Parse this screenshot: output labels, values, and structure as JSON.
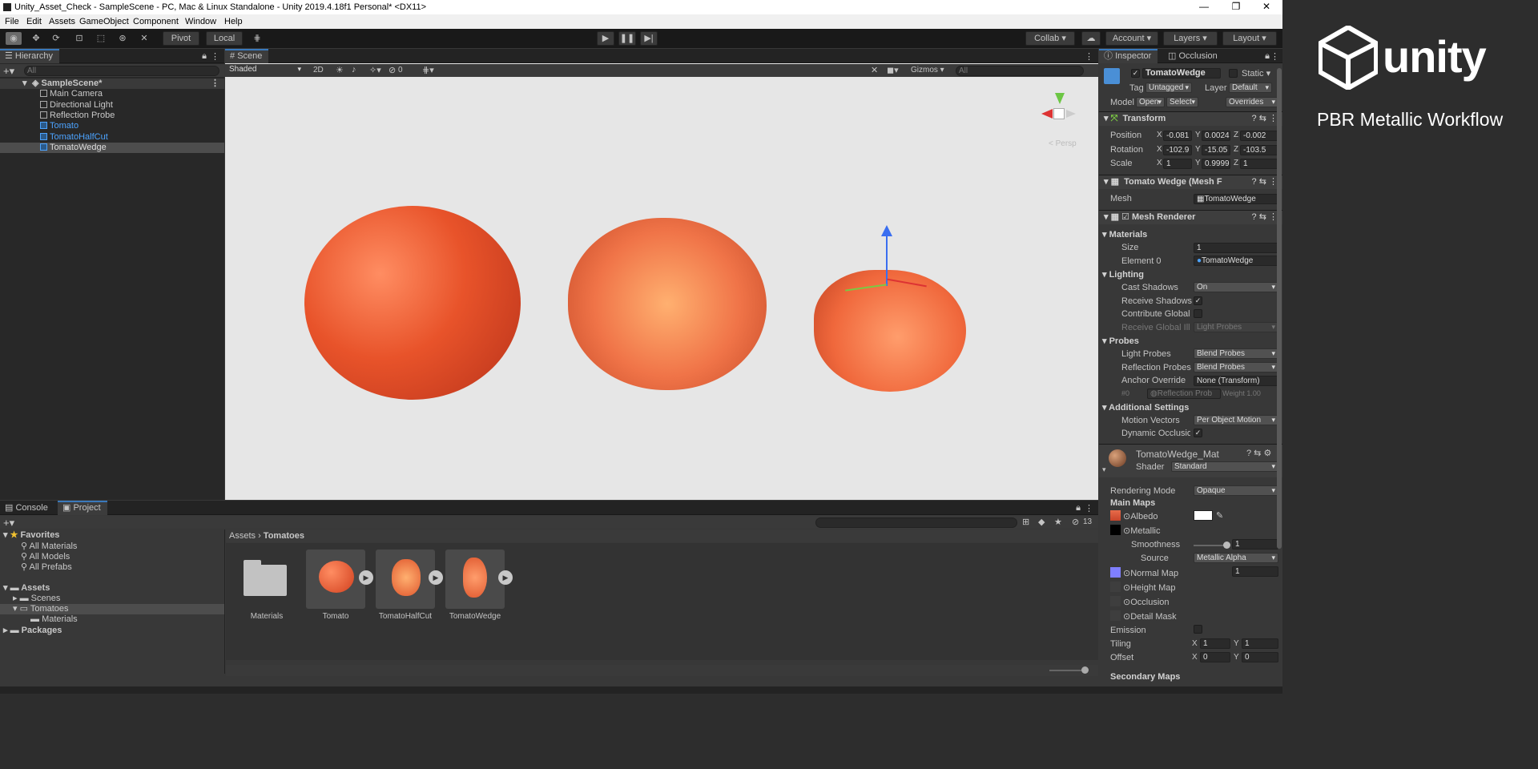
{
  "window": {
    "title": "Unity_Asset_Check - SampleScene - PC, Mac & Linux Standalone - Unity 2019.4.18f1 Personal* <DX11>",
    "minimize": "—",
    "maximize": "❐",
    "close": "✕"
  },
  "menu": [
    "File",
    "Edit",
    "Assets",
    "GameObject",
    "Component",
    "Window",
    "Help"
  ],
  "toolbar": {
    "pivot": "Pivot",
    "local": "Local",
    "collab": "Collab",
    "account": "Account",
    "layers": "Layers",
    "layout": "Layout"
  },
  "hierarchy": {
    "tab": "Hierarchy",
    "search": "All",
    "scene": "SampleScene*",
    "items": [
      "Main Camera",
      "Directional Light",
      "Reflection Probe",
      "Tomato",
      "TomatoHalfCut",
      "TomatoWedge"
    ]
  },
  "scene": {
    "tab": "Scene",
    "shading": "Shaded",
    "mode2d": "2D",
    "hidden_count": "0",
    "gizmos": "Gizmos",
    "search": "All",
    "persp": "< Persp"
  },
  "project": {
    "console_tab": "Console",
    "project_tab": "Project",
    "favorites": "Favorites",
    "fav_items": [
      "All Materials",
      "All Models",
      "All Prefabs"
    ],
    "assets": "Assets",
    "asset_tree": [
      "Scenes",
      "Tomatoes",
      "Materials"
    ],
    "packages": "Packages",
    "breadcrumb": [
      "Assets",
      "Tomatoes"
    ],
    "count": "13",
    "grid_items": [
      "Materials",
      "Tomato",
      "TomatoHalfCut",
      "TomatoWedge"
    ]
  },
  "inspector": {
    "tab": "Inspector",
    "occlusion_tab": "Occlusion",
    "object_name": "TomatoWedge",
    "static": "Static",
    "tag_label": "Tag",
    "tag": "Untagged",
    "layer_label": "Layer",
    "layer": "Default",
    "model_label": "Model",
    "open": "Open",
    "select": "Select",
    "overrides": "Overrides",
    "transform": {
      "title": "Transform",
      "position_label": "Position",
      "rotation_label": "Rotation",
      "scale_label": "Scale",
      "position": [
        "-0.081",
        "0.0024",
        "-0.002"
      ],
      "rotation": [
        "-102.9",
        "-15.05",
        "-103.5"
      ],
      "scale": [
        "1",
        "0.9999",
        "1"
      ]
    },
    "mesh_filter": {
      "title": "Tomato Wedge (Mesh F",
      "mesh_label": "Mesh",
      "mesh": "TomatoWedge"
    },
    "mesh_renderer": {
      "title": "Mesh Renderer",
      "materials": "Materials",
      "size_label": "Size",
      "size": "1",
      "element0_label": "Element 0",
      "element0": "TomatoWedge",
      "lighting": "Lighting",
      "cast_shadows_label": "Cast Shadows",
      "cast_shadows": "On",
      "receive_shadows": "Receive Shadows",
      "contribute_gi": "Contribute Global I",
      "receive_gi": "Receive Global Illu",
      "receive_gi_value": "Light Probes",
      "probes": "Probes",
      "light_probes_label": "Light Probes",
      "light_probes": "Blend Probes",
      "reflection_probes_label": "Reflection Probes",
      "reflection_probes": "Blend Probes",
      "anchor_label": "Anchor Override",
      "anchor": "None (Transform)",
      "probe_index": "#0",
      "probe_name": "Reflection Prob",
      "probe_weight": "Weight 1.00",
      "additional": "Additional Settings",
      "motion_vectors_label": "Motion Vectors",
      "motion_vectors": "Per Object Motion",
      "dynamic_occlusion": "Dynamic Occlusion"
    },
    "material": {
      "name": "TomatoWedge_Mat",
      "shader_label": "Shader",
      "shader": "Standard",
      "rendering_mode_label": "Rendering Mode",
      "rendering_mode": "Opaque",
      "main_maps": "Main Maps",
      "albedo": "Albedo",
      "metallic": "Metallic",
      "smoothness": "Smoothness",
      "smoothness_value": "1",
      "smoothness_level": 1.0,
      "source": "Source",
      "source_value": "Metallic Alpha",
      "normal_map": "Normal Map",
      "normal_scale": "1",
      "height_map": "Height Map",
      "occlusion": "Occlusion",
      "detail_mask": "Detail Mask",
      "emission": "Emission",
      "tiling": "Tiling",
      "tiling_x": "1",
      "tiling_y": "1",
      "offset": "Offset",
      "offset_x": "0",
      "offset_y": "0",
      "secondary": "Secondary Maps"
    }
  },
  "branding": {
    "logo": "unity",
    "subtitle": "PBR Metallic Workflow"
  },
  "colors": {
    "accent": "#3a79bb",
    "tomato": "#e8532a",
    "viewport": "#e6e6e6",
    "background": "#2d2d2d"
  }
}
